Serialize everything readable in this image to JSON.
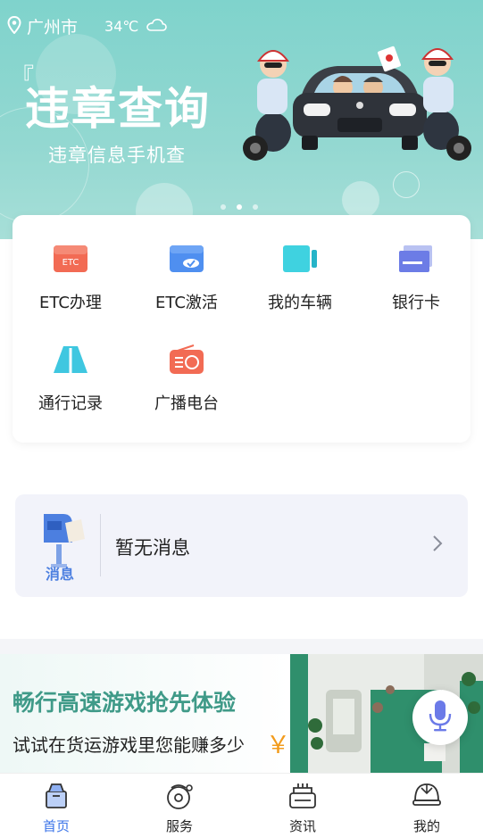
{
  "status": {
    "city": "广州市",
    "temperature": "34℃",
    "weather_icon": "cloud-icon"
  },
  "banner": {
    "quote_mark": "『",
    "title": "违章查询",
    "subtitle": "违章信息手机查",
    "page_count": 3,
    "active_page": 2
  },
  "services": [
    {
      "label": "ETC办理",
      "icon": "etc-card-icon"
    },
    {
      "label": "ETC激活",
      "icon": "etc-activate-icon"
    },
    {
      "label": "我的车辆",
      "icon": "vehicle-icon"
    },
    {
      "label": "银行卡",
      "icon": "bank-card-icon"
    },
    {
      "label": "通行记录",
      "icon": "road-icon"
    },
    {
      "label": "广播电台",
      "icon": "radio-icon"
    }
  ],
  "message": {
    "text": "暂无消息",
    "badge": "消息"
  },
  "promo": {
    "title": "畅行高速游戏抢先体验",
    "subtitle": "试试在货运游戏里您能赚多少",
    "currency": "￥"
  },
  "tabbar": [
    {
      "label": "首页",
      "icon": "home-icon",
      "active": true
    },
    {
      "label": "服务",
      "icon": "service-icon",
      "active": false
    },
    {
      "label": "资讯",
      "icon": "news-icon",
      "active": false
    },
    {
      "label": "我的",
      "icon": "profile-icon",
      "active": false
    }
  ],
  "colors": {
    "accent": "#3a73e8",
    "banner": "#8fd6cf",
    "promo_title": "#3f9a88",
    "yen": "#f29b1c"
  }
}
